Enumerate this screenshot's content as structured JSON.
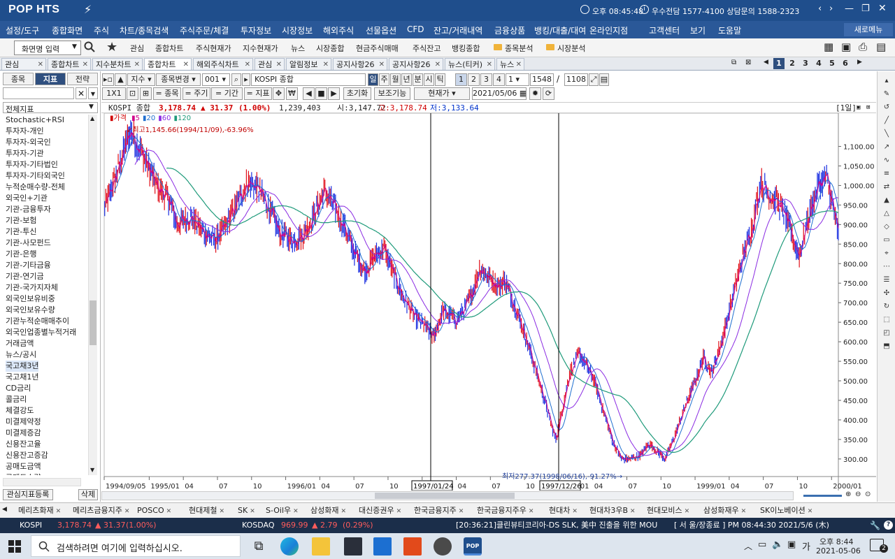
{
  "app": {
    "logo": "POP HTS",
    "clock_text": "오후 08:45:48",
    "phone_text": "우수전담 1577-4100 상담문의 1588-2323"
  },
  "menu": [
    "설정/도구",
    "종합화면",
    "주식",
    "차트/종목검색",
    "주식주문/체결",
    "투자정보",
    "시장정보",
    "해외주식",
    "선물옵션",
    "CFD",
    "잔고/거래내역",
    "금융상품",
    "뱅킹/대출/대여",
    "온라인지점",
    "고객센터",
    "보기",
    "도움말"
  ],
  "menu_refresh": "새로메뉴",
  "toolbar": {
    "screen_input": "화면명 입력",
    "items": [
      "관심",
      "종합차트",
      "주식현재가",
      "지수현재가",
      "뉴스",
      "시장종합",
      "현금주식매매",
      "주식잔고",
      "뱅킹종합"
    ],
    "folders": [
      "종목분석",
      "시장분석"
    ]
  },
  "tabs": [
    "관심",
    "종합차트",
    "지수분차트",
    "종합차트",
    "해외주식차트",
    "관심",
    "알림정보",
    "공지사항26",
    "공지사항26",
    "뉴스(티커)",
    "뉴스"
  ],
  "page_numbers": [
    "1",
    "2",
    "3",
    "4",
    "5",
    "6"
  ],
  "left_panel": {
    "tabs": [
      "종목",
      "지표",
      "전략"
    ],
    "category": "전체지표",
    "items": [
      "Stochastic+RSI",
      "투자자-개인",
      "투자자-외국인",
      "투자자-기관",
      "투자자-기타법인",
      "투자자-기타외국인",
      "누적순매수량-전체",
      "외국인+기관",
      "기관-금융투자",
      "기관-보험",
      "기관-투신",
      "기관-사모펀드",
      "기관-은행",
      "기관-기타금융",
      "기관-연기금",
      "기관-국가지자체",
      "외국인보유비중",
      "외국인보유수량",
      "기관누적순매매추이",
      "외국인업종별누적거래",
      "거래금액",
      "뉴스/공시",
      "국고채3년",
      "국고채1년",
      "CD금리",
      "콜금리",
      "체결강도",
      "미결제약정",
      "미결제증감",
      "신용잔고율",
      "신용잔고증감",
      "공매도금액",
      "공매도수량"
    ],
    "selected_index": 22,
    "register_btn": "관심지표등록",
    "delete_btn": "삭제"
  },
  "chart_toolbar": {
    "mode": "지수",
    "change_stock": "종목변경",
    "code": "001",
    "name": "KOSPI 종합",
    "periods": [
      "일",
      "주",
      "월",
      "년",
      "분",
      "시",
      "틱"
    ],
    "active_period": "일",
    "nums": [
      "1",
      "2",
      "3",
      "4"
    ],
    "count_value": "1",
    "count_a": "1548",
    "count_b": "1108",
    "row2": [
      "1X1",
      "종목",
      "주기",
      "기간",
      "지표"
    ],
    "init_btn": "초기화",
    "aux_btn": "보조기능",
    "price_type": "현재가",
    "date": "2021/05/06"
  },
  "chart_info": {
    "name": "KOSPI 종합",
    "price": "3,178.74",
    "change": "▲ 31.37",
    "pct": "(1.00%)",
    "volume": "1,239,403",
    "open": "시:3,147.72",
    "high": "고:3,178.74",
    "low": "저:3,133.64",
    "period_tag": "[1일]"
  },
  "legend": {
    "title": "가격",
    "ma": [
      "5",
      "20",
      "60",
      "120"
    ],
    "ma_colors": [
      "#d0008a",
      "#1f6fd0",
      "#8a2be2",
      "#1e9a7a"
    ]
  },
  "annotations": {
    "high": "최고1,145.66(1994/11/09),-63.96%",
    "low": "최저277.37(1998/06/16),-91.27%"
  },
  "crosshair_labels": [
    "1997/01/24",
    "1997/12/26"
  ],
  "chart_data": {
    "type": "line",
    "title": "KOSPI 종합",
    "y_ticks": [
      300,
      350,
      400,
      450,
      500,
      550,
      600,
      650,
      700,
      750,
      800,
      850,
      900,
      950,
      1000,
      1050,
      1100
    ],
    "y_tick_labels": [
      "300.00",
      "350.00",
      "400.00",
      "450.00",
      "500.00",
      "550.00",
      "600.00",
      "650.00",
      "700.00",
      "750.00",
      "800.00",
      "850.00",
      "900.00",
      "950.00",
      "1,000.00",
      "1,050.00",
      "1,100.00"
    ],
    "ylim": [
      255,
      1185
    ],
    "x_tick_labels": [
      "1994/09/05",
      "1995/01",
      "04",
      "07",
      "10",
      "1996/01",
      "04",
      "07",
      "10",
      "1997/01",
      "04",
      "07",
      "10",
      "1998/01",
      "04",
      "07",
      "10",
      "1999/01",
      "04",
      "07",
      "10",
      "2000/01"
    ],
    "x_tick_times": [
      1994.67,
      1995.0,
      1995.25,
      1995.5,
      1995.75,
      1996.0,
      1996.25,
      1996.5,
      1996.75,
      1997.0,
      1997.25,
      1997.5,
      1997.75,
      1998.0,
      1998.25,
      1998.5,
      1998.75,
      1999.0,
      1999.25,
      1999.5,
      1999.75,
      2000.0
    ],
    "xlim": [
      1994.67,
      2000.05
    ],
    "series": [
      {
        "values": [
          [
            1994.67,
            940
          ],
          [
            1994.75,
            1020
          ],
          [
            1994.86,
            1140
          ],
          [
            1994.95,
            1080
          ],
          [
            1995.05,
            1000
          ],
          [
            1995.15,
            960
          ],
          [
            1995.2,
            900
          ],
          [
            1995.3,
            920
          ],
          [
            1995.4,
            880
          ],
          [
            1995.48,
            860
          ],
          [
            1995.55,
            890
          ],
          [
            1995.65,
            960
          ],
          [
            1995.72,
            1010
          ],
          [
            1995.8,
            990
          ],
          [
            1995.88,
            940
          ],
          [
            1995.95,
            880
          ],
          [
            1996.05,
            860
          ],
          [
            1996.12,
            870
          ],
          [
            1996.2,
            920
          ],
          [
            1996.28,
            985
          ],
          [
            1996.33,
            960
          ],
          [
            1996.42,
            900
          ],
          [
            1996.5,
            830
          ],
          [
            1996.58,
            780
          ],
          [
            1996.65,
            820
          ],
          [
            1996.72,
            840
          ],
          [
            1996.78,
            780
          ],
          [
            1996.85,
            720
          ],
          [
            1996.95,
            660
          ],
          [
            1997.02,
            640
          ],
          [
            1997.08,
            610
          ],
          [
            1997.15,
            680
          ],
          [
            1997.25,
            655
          ],
          [
            1997.32,
            690
          ],
          [
            1997.38,
            740
          ],
          [
            1997.42,
            790
          ],
          [
            1997.5,
            760
          ],
          [
            1997.57,
            740
          ],
          [
            1997.6,
            760
          ],
          [
            1997.68,
            690
          ],
          [
            1997.75,
            620
          ],
          [
            1997.82,
            540
          ],
          [
            1997.88,
            470
          ],
          [
            1997.95,
            380
          ],
          [
            1997.98,
            350
          ],
          [
            1998.02,
            420
          ],
          [
            1998.08,
            520
          ],
          [
            1998.15,
            570
          ],
          [
            1998.2,
            540
          ],
          [
            1998.26,
            500
          ],
          [
            1998.32,
            430
          ],
          [
            1998.4,
            340
          ],
          [
            1998.46,
            300
          ],
          [
            1998.52,
            300
          ],
          [
            1998.6,
            310
          ],
          [
            1998.66,
            340
          ],
          [
            1998.72,
            320
          ],
          [
            1998.78,
            300
          ],
          [
            1998.85,
            360
          ],
          [
            1998.92,
            430
          ],
          [
            1999.0,
            500
          ],
          [
            1999.06,
            560
          ],
          [
            1999.12,
            520
          ],
          [
            1999.2,
            610
          ],
          [
            1999.27,
            710
          ],
          [
            1999.35,
            820
          ],
          [
            1999.42,
            900
          ],
          [
            1999.48,
            1010
          ],
          [
            1999.53,
            980
          ],
          [
            1999.6,
            960
          ],
          [
            1999.65,
            930
          ],
          [
            1999.7,
            880
          ],
          [
            1999.76,
            820
          ],
          [
            1999.83,
            920
          ],
          [
            1999.9,
            1000
          ],
          [
            1999.96,
            1020
          ],
          [
            2000.0,
            960
          ],
          [
            2000.05,
            870
          ]
        ]
      }
    ]
  },
  "bottom_tabs": [
    "메리츠화재",
    "메리츠금융지주",
    "POSCO",
    "현대제철",
    "SK",
    "S-Oil우",
    "삼성화재",
    "대신증권우",
    "한국금융지주",
    "한국금융지주우",
    "현대차",
    "현대차3우B",
    "현대모비스",
    "삼성화재우",
    "SK이노베이션"
  ],
  "ticker": {
    "kospi_label": "KOSPI",
    "kospi_value": "3,178.74",
    "kospi_change": "▲ 31.37",
    "kospi_pct": "(1.00%)",
    "kosdaq_label": "KOSDAQ",
    "kosdaq_value": "969.99",
    "kosdaq_change": "▲ 2.79",
    "kosdaq_pct": "(0.29%)",
    "news": "[20:36:21]클린뷰티코리아-DS SLK, 美中 진출을 위한 MOU",
    "status": "[ 서  울/장종료 ] PM 08:44:30  2021/5/6 (木)"
  },
  "taskbar": {
    "search_placeholder": "검색하려면 여기에 입력하십시오.",
    "lang": "가",
    "time": "오후 8:44",
    "date": "2021-05-06",
    "notif_count": "2"
  }
}
